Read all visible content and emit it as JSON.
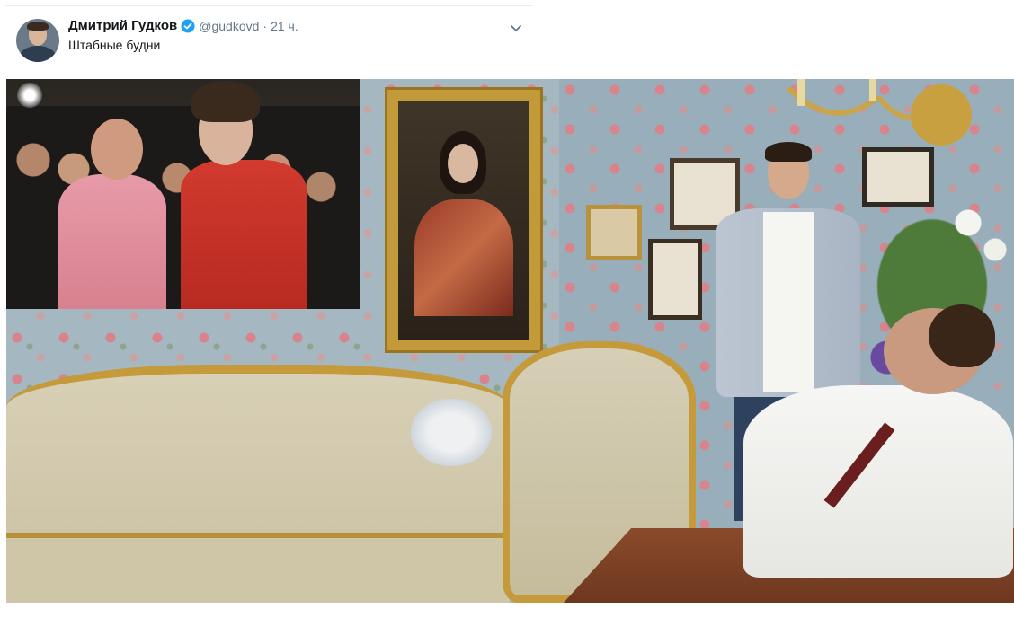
{
  "tweet": {
    "author_name": "Дмитрий Гудков",
    "handle": "@gudkovd",
    "separator": "·",
    "time": "21 ч.",
    "text": "Штабные будни"
  },
  "icons": {
    "verified": "verified-badge-icon",
    "menu": "chevron-down-icon"
  },
  "colors": {
    "verified_blue": "#1da1f2",
    "text_primary": "#14171a",
    "text_secondary": "#657786"
  }
}
